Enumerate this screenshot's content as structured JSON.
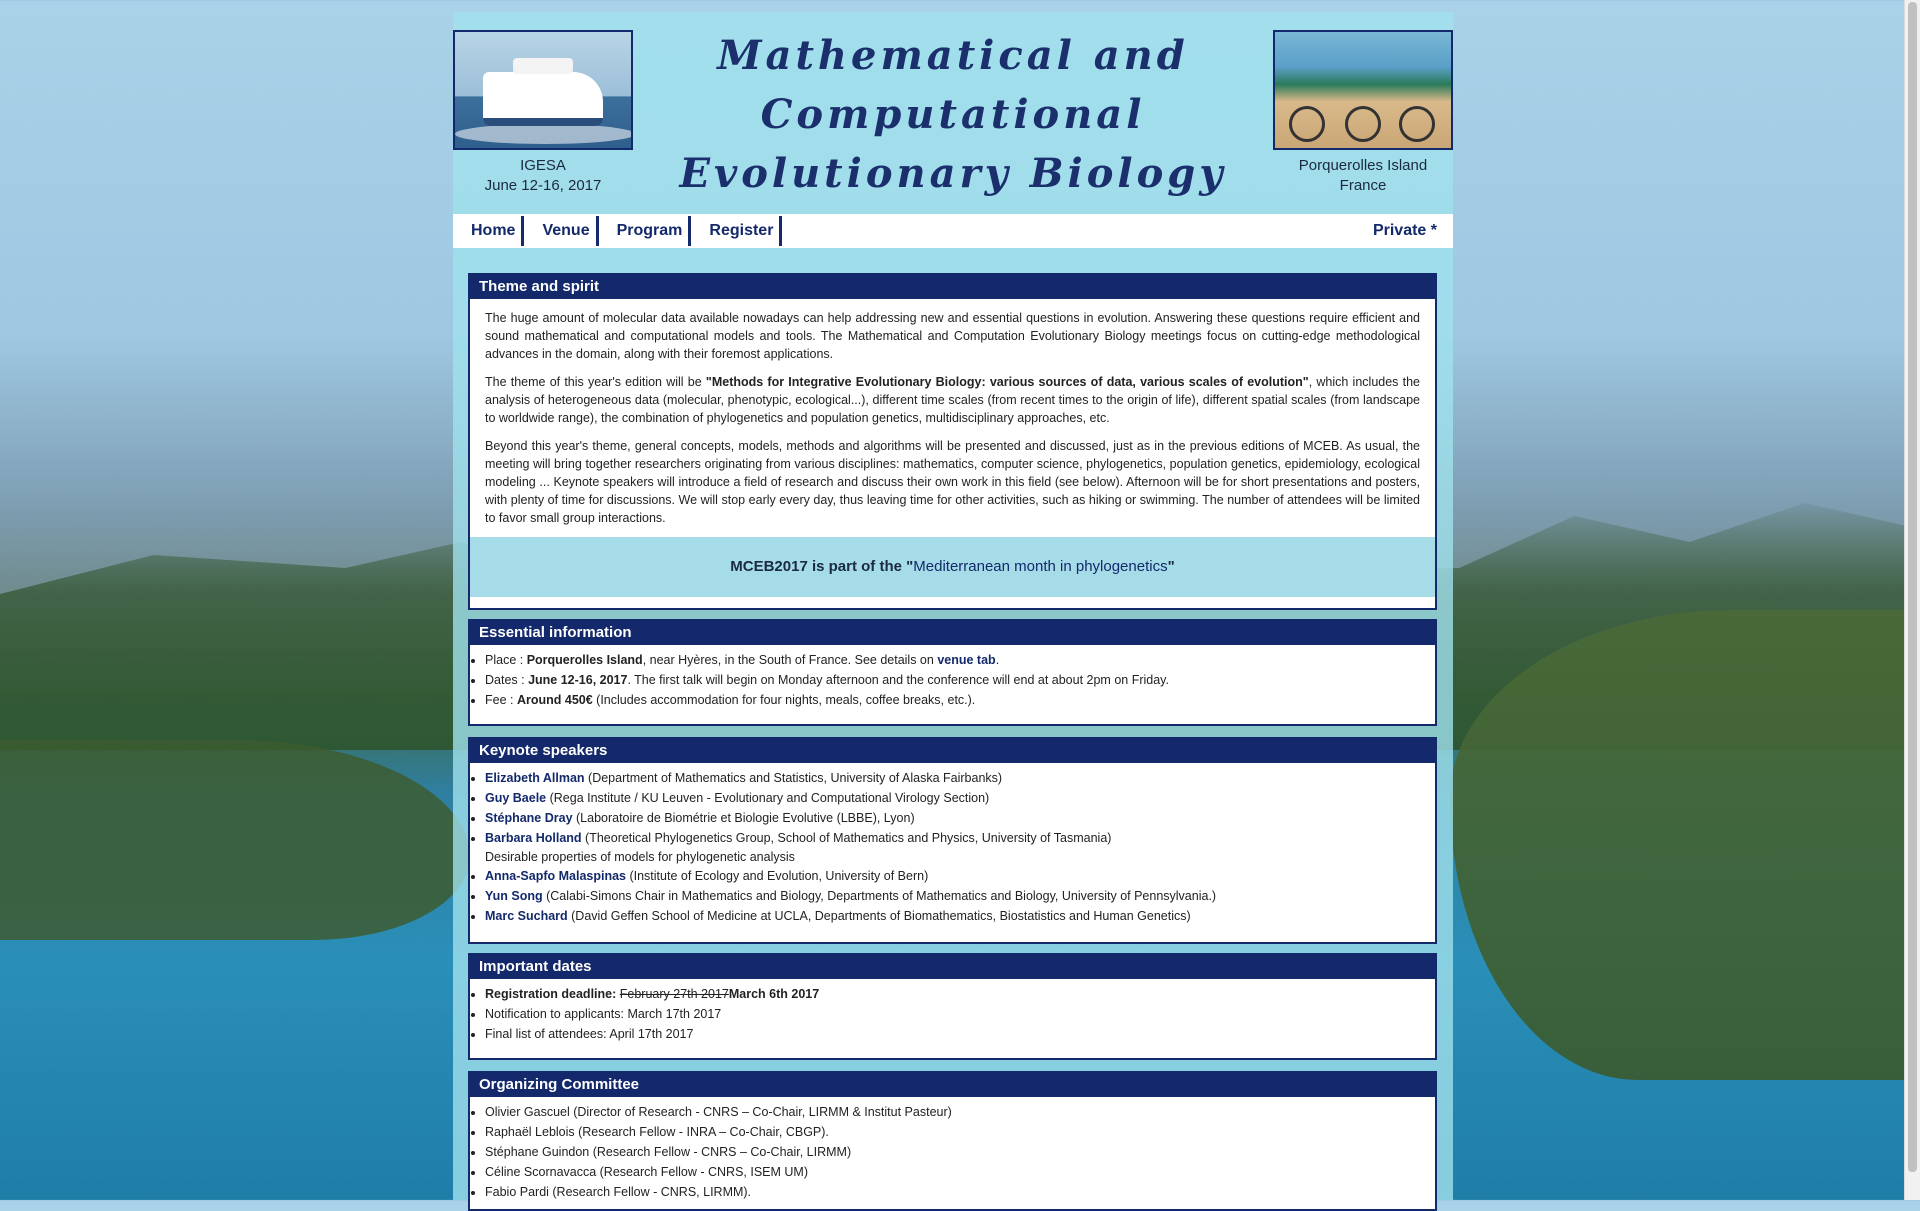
{
  "header": {
    "title_lines": [
      "Mathematical and",
      "Computational",
      "Evolutionary Biology"
    ],
    "left_caption": {
      "line1": "IGESA",
      "line2": "June 12-16, 2017"
    },
    "right_caption": {
      "line1": "Porquerolles Island",
      "line2": "France"
    }
  },
  "nav": {
    "items": [
      "Home",
      "Venue",
      "Program",
      "Register"
    ],
    "private": "Private *"
  },
  "theme": {
    "heading": "Theme and spirit",
    "p1": "The huge amount of molecular data available nowadays can help addressing new and essential questions in evolution. Answering these questions require efficient and sound mathematical and computational models and tools. The Mathematical and Computation Evolutionary Biology meetings focus on cutting-edge methodological advances in the domain, along with their foremost applications.",
    "p2_before": "The theme of this year's edition will be ",
    "p2_bold": "\"Methods for Integrative Evolutionary Biology: various sources of data, various scales of evolution\"",
    "p2_after": ", which includes the analysis of heterogeneous data (molecular, phenotypic, ecological...), different time scales (from recent times to the origin of life), different spatial scales (from landscape to worldwide range), the combination of phylogenetics and population genetics, multidisciplinary approaches, etc.",
    "p3": "Beyond this year's theme, general concepts, models, methods and algorithms will be presented and discussed, just as in the previous editions of MCEB. As usual, the meeting will bring together researchers originating from various disciplines: mathematics, computer science, phylogenetics, population genetics, epidemiology, ecological modeling ... Keynote speakers will introduce a field of research and discuss their own work in this field (see below). Afternoon will be for short presentations and posters, with plenty of time for discussions. We will stop early every day, thus leaving time for other activities, such as hiking or swimming. The number of attendees will be limited to favor small group interactions.",
    "banner_before": "MCEB2017 is part of the \"",
    "banner_link": "Mediterranean month in phylogenetics",
    "banner_after": "\""
  },
  "essential": {
    "heading": "Essential information",
    "place_label": "Place : ",
    "place_bold": "Porquerolles Island",
    "place_mid": ", near Hyères, in the South of France. See details on ",
    "place_link": "venue tab",
    "place_end": ".",
    "dates_label": "Dates : ",
    "dates_bold": "June 12-16, 2017",
    "dates_rest": ". The first talk will begin on Monday afternoon and the conference will end at about 2pm on Friday.",
    "fee_label": "Fee : ",
    "fee_bold": "Around 450€",
    "fee_rest": " (Includes accommodation for four nights, meals, coffee breaks, etc.)."
  },
  "keynote": {
    "heading": "Keynote speakers",
    "speakers": [
      {
        "name": "Elizabeth Allman",
        "affil": " (Department of Mathematics and Statistics, University of Alaska Fairbanks)"
      },
      {
        "name": "Guy Baele",
        "affil": " (Rega Institute / KU Leuven - Evolutionary and Computational Virology Section)"
      },
      {
        "name": "Stéphane Dray",
        "affil": " (Laboratoire de Biométrie et Biologie Evolutive (LBBE), Lyon)"
      },
      {
        "name": "Barbara Holland",
        "affil": " (Theoretical Phylogenetics Group, School of Mathematics and Physics, University of Tasmania)",
        "talk": "Desirable properties of models for phylogenetic analysis"
      },
      {
        "name": "Anna-Sapfo Malaspinas",
        "affil": " (Institute of Ecology and Evolution, University of Bern)"
      },
      {
        "name": "Yun Song",
        "affil": " (Calabi-Simons Chair in Mathematics and Biology, Departments of Mathematics and Biology, University of Pennsylvania.)"
      },
      {
        "name": "Marc Suchard",
        "affil": " (David Geffen School of Medicine at UCLA, Departments of Biomathematics, Biostatistics and Human Genetics)"
      }
    ]
  },
  "dates": {
    "heading": "Important dates",
    "reg_label": "Registration deadline: ",
    "reg_old": "February 27th 2017",
    "reg_new": "March 6th 2017",
    "notification": "Notification to applicants: March 17th 2017",
    "final": "Final list of attendees: April 17th 2017"
  },
  "committee": {
    "heading": "Organizing Committee",
    "members": [
      "Olivier Gascuel (Director of Research - CNRS – Co-Chair, LIRMM & Institut Pasteur)",
      "Raphaël Leblois (Research Fellow - INRA – Co-Chair, CBGP).",
      "Stéphane Guindon (Research Fellow - CNRS – Co-Chair, LIRMM)",
      "Céline Scornavacca (Research Fellow - CNRS, ISEM UM)",
      "Fabio Pardi (Research Fellow - CNRS, LIRMM)."
    ]
  }
}
